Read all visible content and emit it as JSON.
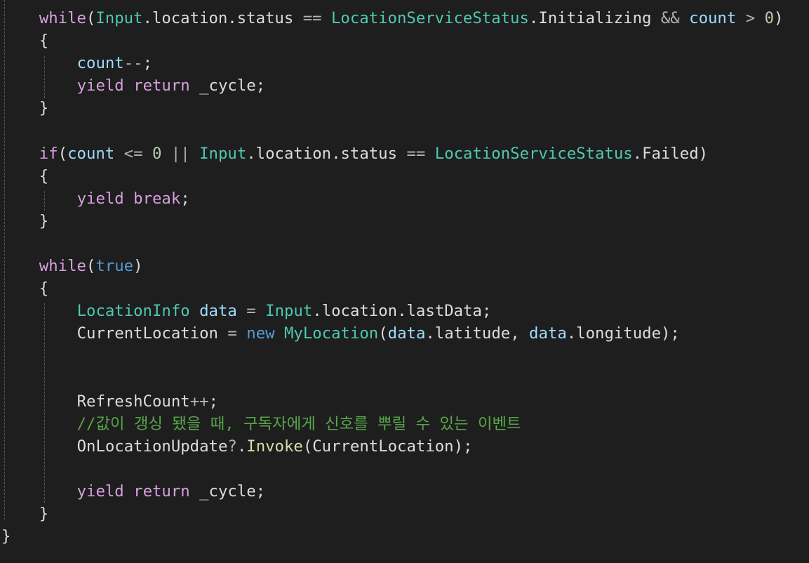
{
  "editor": {
    "language": "csharp",
    "colors": {
      "background": "#1e1e1e",
      "plain": "#dcdcdc",
      "control_keyword": "#d8a0df",
      "keyword": "#569cd6",
      "type": "#4ec9b0",
      "variable": "#9cdcfe",
      "number": "#b5cea8",
      "method": "#dcdcaa",
      "comment": "#57a64a",
      "indent_guide": "#5a5a5a"
    },
    "lines": [
      {
        "indent": 2,
        "tokens": [
          [
            "kw-ctrl",
            "while"
          ],
          [
            "plain",
            "("
          ],
          [
            "type",
            "Input"
          ],
          [
            "plain",
            ".location.status "
          ],
          [
            "op",
            "=="
          ],
          [
            "plain",
            " "
          ],
          [
            "type",
            "LocationServiceStatus"
          ],
          [
            "plain",
            ".Initializing "
          ],
          [
            "op",
            "&&"
          ],
          [
            "plain",
            " "
          ],
          [
            "var",
            "count"
          ],
          [
            "plain",
            " "
          ],
          [
            "op",
            ">"
          ],
          [
            "plain",
            " "
          ],
          [
            "num",
            "0"
          ],
          [
            "plain",
            ")"
          ]
        ]
      },
      {
        "indent": 2,
        "tokens": [
          [
            "plain",
            "{"
          ]
        ]
      },
      {
        "indent": 4,
        "tokens": [
          [
            "var",
            "count"
          ],
          [
            "op",
            "--"
          ],
          [
            "plain",
            ";"
          ]
        ]
      },
      {
        "indent": 4,
        "tokens": [
          [
            "kw-ctrl",
            "yield"
          ],
          [
            "plain",
            " "
          ],
          [
            "kw-ctrl",
            "return"
          ],
          [
            "plain",
            " _cycle;"
          ]
        ]
      },
      {
        "indent": 2,
        "tokens": [
          [
            "plain",
            "}"
          ]
        ]
      },
      {
        "indent": 0,
        "tokens": []
      },
      {
        "indent": 2,
        "tokens": [
          [
            "kw-ctrl",
            "if"
          ],
          [
            "plain",
            "("
          ],
          [
            "var",
            "count"
          ],
          [
            "plain",
            " "
          ],
          [
            "op",
            "<="
          ],
          [
            "plain",
            " "
          ],
          [
            "num",
            "0"
          ],
          [
            "plain",
            " "
          ],
          [
            "op",
            "||"
          ],
          [
            "plain",
            " "
          ],
          [
            "type",
            "Input"
          ],
          [
            "plain",
            ".location.status "
          ],
          [
            "op",
            "=="
          ],
          [
            "plain",
            " "
          ],
          [
            "type",
            "LocationServiceStatus"
          ],
          [
            "plain",
            ".Failed)"
          ]
        ]
      },
      {
        "indent": 2,
        "tokens": [
          [
            "plain",
            "{"
          ]
        ]
      },
      {
        "indent": 4,
        "tokens": [
          [
            "kw-ctrl",
            "yield"
          ],
          [
            "plain",
            " "
          ],
          [
            "kw-ctrl",
            "break"
          ],
          [
            "plain",
            ";"
          ]
        ]
      },
      {
        "indent": 2,
        "tokens": [
          [
            "plain",
            "}"
          ]
        ]
      },
      {
        "indent": 0,
        "tokens": []
      },
      {
        "indent": 2,
        "tokens": [
          [
            "kw-ctrl",
            "while"
          ],
          [
            "plain",
            "("
          ],
          [
            "kw",
            "true"
          ],
          [
            "plain",
            ")"
          ]
        ]
      },
      {
        "indent": 2,
        "tokens": [
          [
            "plain",
            "{"
          ]
        ]
      },
      {
        "indent": 4,
        "tokens": [
          [
            "type",
            "LocationInfo"
          ],
          [
            "plain",
            " "
          ],
          [
            "var",
            "data"
          ],
          [
            "plain",
            " "
          ],
          [
            "op",
            "="
          ],
          [
            "plain",
            " "
          ],
          [
            "type",
            "Input"
          ],
          [
            "plain",
            ".location.lastData;"
          ]
        ]
      },
      {
        "indent": 4,
        "tokens": [
          [
            "plain",
            "CurrentLocation "
          ],
          [
            "op",
            "="
          ],
          [
            "plain",
            " "
          ],
          [
            "kw",
            "new"
          ],
          [
            "plain",
            " "
          ],
          [
            "type",
            "MyLocation"
          ],
          [
            "plain",
            "("
          ],
          [
            "var",
            "data"
          ],
          [
            "plain",
            ".latitude, "
          ],
          [
            "var",
            "data"
          ],
          [
            "plain",
            ".longitude);"
          ]
        ]
      },
      {
        "indent": 0,
        "tokens": []
      },
      {
        "indent": 0,
        "tokens": []
      },
      {
        "indent": 4,
        "tokens": [
          [
            "plain",
            "RefreshCount"
          ],
          [
            "op",
            "++"
          ],
          [
            "plain",
            ";"
          ]
        ]
      },
      {
        "indent": 4,
        "tokens": [
          [
            "comment",
            "//값이 갱싱 됐을 때, 구독자에게 신호를 뿌릴 수 있는 이벤트"
          ]
        ]
      },
      {
        "indent": 4,
        "tokens": [
          [
            "plain",
            "OnLocationUpdate"
          ],
          [
            "op",
            "?"
          ],
          [
            "plain",
            "."
          ],
          [
            "method",
            "Invoke"
          ],
          [
            "plain",
            "(CurrentLocation);"
          ]
        ]
      },
      {
        "indent": 0,
        "tokens": []
      },
      {
        "indent": 4,
        "tokens": [
          [
            "kw-ctrl",
            "yield"
          ],
          [
            "plain",
            " "
          ],
          [
            "kw-ctrl",
            "return"
          ],
          [
            "plain",
            " _cycle;"
          ]
        ]
      },
      {
        "indent": 2,
        "tokens": [
          [
            "plain",
            "}"
          ]
        ]
      },
      {
        "indent": 0,
        "tokens": [
          [
            "plain",
            "}"
          ]
        ]
      }
    ]
  }
}
